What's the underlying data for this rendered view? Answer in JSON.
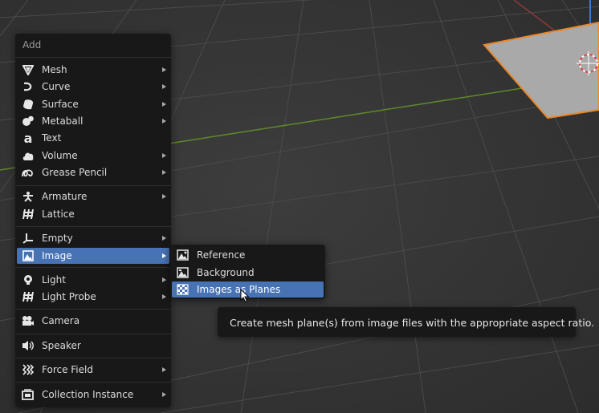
{
  "menu": {
    "title": "Add",
    "items": [
      {
        "label": "Mesh",
        "icon": "mesh-icon"
      },
      {
        "label": "Curve",
        "icon": "curve-icon"
      },
      {
        "label": "Surface",
        "icon": "surface-icon"
      },
      {
        "label": "Metaball",
        "icon": "metaball-icon"
      },
      {
        "label": "Text",
        "icon": "text-icon"
      },
      {
        "label": "Volume",
        "icon": "volume-icon"
      },
      {
        "label": "Grease Pencil",
        "icon": "grease-pencil-icon"
      },
      {
        "label": "Armature",
        "icon": "armature-icon"
      },
      {
        "label": "Lattice",
        "icon": "lattice-icon"
      },
      {
        "label": "Empty",
        "icon": "empty-icon"
      },
      {
        "label": "Image",
        "icon": "image-icon"
      },
      {
        "label": "Light",
        "icon": "light-icon"
      },
      {
        "label": "Light Probe",
        "icon": "light-probe-icon"
      },
      {
        "label": "Camera",
        "icon": "camera-icon"
      },
      {
        "label": "Speaker",
        "icon": "speaker-icon"
      },
      {
        "label": "Force Field",
        "icon": "force-field-icon"
      },
      {
        "label": "Collection Instance",
        "icon": "collection-instance-icon"
      }
    ]
  },
  "submenu": {
    "items": [
      {
        "label": "Reference",
        "icon": "image-reference-icon"
      },
      {
        "label": "Background",
        "icon": "image-background-icon"
      },
      {
        "label": "Images as Planes",
        "icon": "checker-image-icon"
      }
    ]
  },
  "tooltip": {
    "text": "Create mesh plane(s) from image files with the appropriate aspect ratio."
  },
  "colors": {
    "highlight": "#4772b3",
    "menu_bg": "#181818",
    "viewport_bg": "#393939",
    "selection_outline": "#e8862a"
  }
}
